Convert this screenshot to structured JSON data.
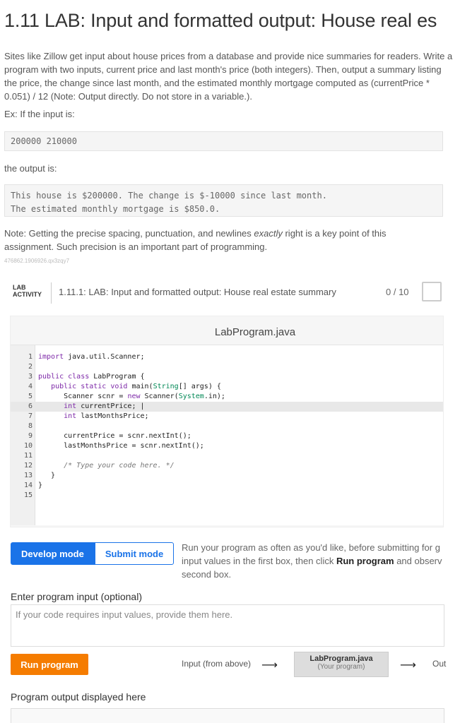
{
  "title": "1.11 LAB: Input and formatted output: House real es",
  "description": {
    "paragraph": "Sites like Zillow get input about house prices from a database and provide nice summaries for readers. Write a program with two inputs, current price and last month's price (both integers). Then, output a summary listing the price, the change since last month, and the estimated monthly mortgage computed as (currentPrice * 0.051) / 12 (Note: Output directly. Do not store in a variable.).",
    "example_intro": "Ex: If the input is:",
    "example_input": "200000 210000",
    "output_intro": "the output is:",
    "example_output_line1": "This house is $200000. The change is $-10000 since last month.",
    "example_output_line2": "The estimated monthly mortgage is $850.0.",
    "note_before": "Note: Getting the precise spacing, punctuation, and newlines ",
    "note_italic": "exactly",
    "note_after": " right is a key point of this assignment. Such precision is an important part of programming.",
    "tracking_id": "476862.1906926.qx3zqy7"
  },
  "lab": {
    "tag_line1": "LAB",
    "tag_line2": "ACTIVITY",
    "activity_title": "1.11.1: LAB: Input and formatted output: House real estate summary",
    "score": "0 / 10"
  },
  "editor": {
    "filename": "LabProgram.java",
    "line_numbers": [
      "1",
      "2",
      "3",
      "4",
      "5",
      "6",
      "7",
      "8",
      "9",
      "10",
      "11",
      "12",
      "13",
      "14",
      "15"
    ]
  },
  "modes": {
    "develop": "Develop mode",
    "submit": "Submit mode",
    "help_before": "Run your program as often as you'd like, before submitting for g",
    "help_line2_before": "input values in the first box, then click ",
    "help_bold1": "Run program",
    "help_line2_after": " and observ",
    "help_line3": "second box."
  },
  "program_input": {
    "label": "Enter program input (optional)",
    "placeholder": "If your code requires input values, provide them here."
  },
  "run": {
    "button": "Run program",
    "flow_input": "Input (from above)",
    "flow_program": "LabProgram.java",
    "flow_program_sub": "(Your program)",
    "flow_output": "Out"
  },
  "output": {
    "label": "Program output displayed here"
  }
}
